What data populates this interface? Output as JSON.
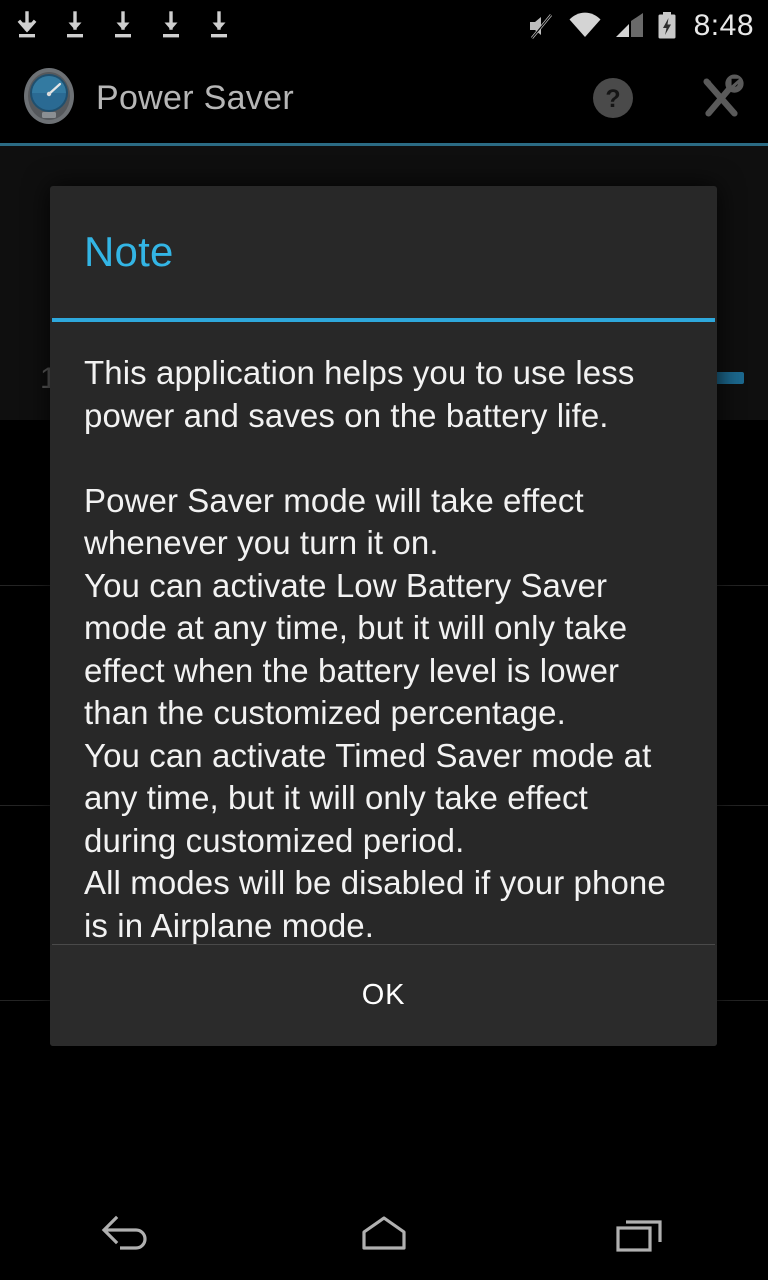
{
  "status_bar": {
    "download_icons": [
      "download-icon",
      "download-icon",
      "download-icon",
      "download-icon",
      "download-icon"
    ],
    "mute_icon": "volume-mute-icon",
    "wifi_icon": "wifi-icon",
    "signal_icon": "cellular-signal-icon",
    "battery_icon": "battery-charging-icon",
    "clock": "8:48"
  },
  "action_bar": {
    "app_icon": "speedometer-gauge-icon",
    "title": "Power Saver",
    "help_icon": "help-question-circle-icon",
    "tools_icon": "wrench-screwdriver-tools-icon",
    "divider_color": "#2b6b84"
  },
  "background": {
    "row_label": "1",
    "accent_chip_color": "#1c698f"
  },
  "dialog": {
    "title": "Note",
    "title_color": "#33b5e5",
    "rule_color": "#2ea8dc",
    "message": "This application helps you to use less power and saves on the battery life.\n\nPower Saver mode will take effect whenever you turn it on.\nYou can activate Low Battery Saver mode at any time, but it will only take effect when the battery level is lower than the customized percentage.\nYou can activate Timed Saver mode at any time, but it will only take effect during customized period.\nAll modes will be disabled if your phone is in Airplane mode.",
    "ok_label": "OK"
  },
  "nav_bar": {
    "back_icon": "back-arrow-icon",
    "home_icon": "home-icon",
    "recents_icon": "recent-apps-icon"
  }
}
